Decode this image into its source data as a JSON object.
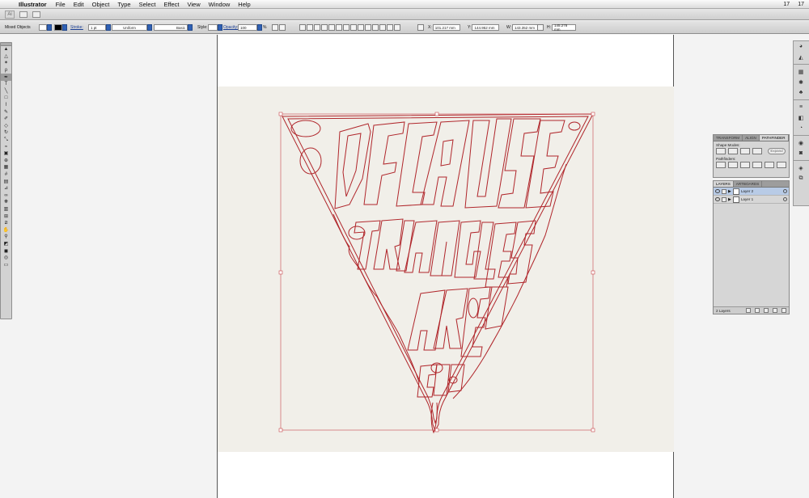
{
  "menubar": {
    "app_name": "Illustrator",
    "items": [
      "File",
      "Edit",
      "Object",
      "Type",
      "Select",
      "Effect",
      "View",
      "Window",
      "Help"
    ],
    "right_items": [
      "17",
      "17"
    ]
  },
  "controlbar": {
    "selection_label": "Mixed Objects",
    "stroke_label": "Stroke:",
    "stroke_weight": "1 pt",
    "profile_value": "Uniform",
    "brush_value": "Basic",
    "style_label": "Style:",
    "opacity_label": "Opacity:",
    "opacity_value": "100",
    "opacity_unit": "%",
    "x_label": "X:",
    "x_value": "101.217 mm",
    "y_label": "Y:",
    "y_value": "144.952 mm",
    "w_label": "W:",
    "w_value": "143.352 mm",
    "h_label": "H:",
    "h_value": "145.278 mm"
  },
  "pathfinder_panel": {
    "tabs": [
      "TRANSFORM",
      "ALIGN",
      "PATHFINDER"
    ],
    "shape_modes_label": "Shape Modes:",
    "pathfinders_label": "Pathfinders:",
    "expand_label": "Expand"
  },
  "layers_panel": {
    "tabs": [
      "LAYERS",
      "ARTBOARDS"
    ],
    "layers": [
      {
        "name": "Layer 2"
      },
      {
        "name": "Layer 1"
      }
    ],
    "footer_count": "2 Layers"
  },
  "artwork": {
    "stroke_color": "#b0262b",
    "bbox_color": "#c9474c"
  }
}
